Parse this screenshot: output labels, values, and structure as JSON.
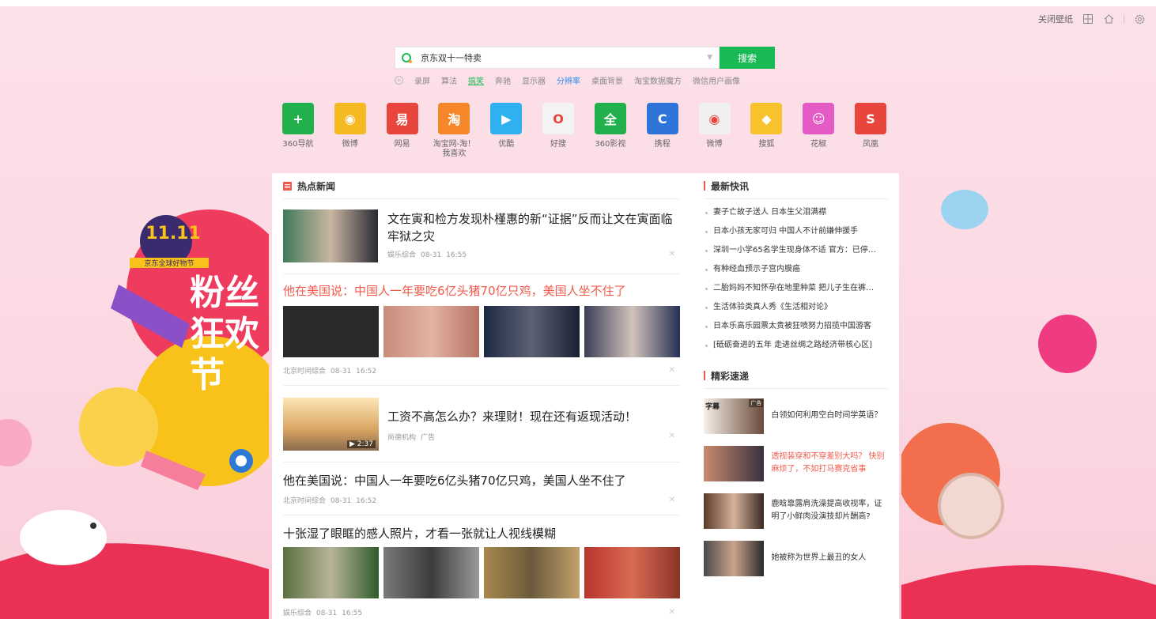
{
  "toolbar": {
    "close_wallpaper": "关闭壁纸"
  },
  "search": {
    "value": "京东双十一特卖",
    "button": "搜索"
  },
  "hot_words": [
    "录屏",
    "算法",
    "搞笑",
    "奔驰",
    "显示器",
    "分辨率",
    "桌面背景",
    "淘宝数据魔方",
    "微信用户画像"
  ],
  "sites": [
    {
      "label": "360导航",
      "glyph": "+",
      "color": "#21b04b",
      "icon": "plus-circle-icon"
    },
    {
      "label": "微博",
      "glyph": "◉",
      "color": "#f5b921",
      "icon": "weibo-icon"
    },
    {
      "label": "网易",
      "glyph": "易",
      "color": "#e8453c",
      "icon": "netease-icon"
    },
    {
      "label": "淘宝网-淘！我喜欢",
      "glyph": "淘",
      "color": "#f5862a",
      "icon": "taobao-icon"
    },
    {
      "label": "优酷",
      "glyph": "▶",
      "color": "#2fb1ef",
      "icon": "youku-icon"
    },
    {
      "label": "好搜",
      "glyph": "O",
      "color": "#f3f3f3",
      "icon": "haosou-icon"
    },
    {
      "label": "360影视",
      "glyph": "全",
      "color": "#21b04b",
      "icon": "360-video-icon"
    },
    {
      "label": "携程",
      "glyph": "C",
      "color": "#2f74d9",
      "icon": "ctrip-icon"
    },
    {
      "label": "微博",
      "glyph": "◉",
      "color": "#f0f0f0",
      "icon": "weibo-icon"
    },
    {
      "label": "搜狐",
      "glyph": "◆",
      "color": "#f7c22b",
      "icon": "sohu-icon"
    },
    {
      "label": "花椒",
      "glyph": "☺",
      "color": "#e55bc6",
      "icon": "huajiao-icon"
    },
    {
      "label": "凤凰",
      "glyph": "S",
      "color": "#e8453c",
      "icon": "ifeng-icon"
    }
  ],
  "hot_news": {
    "heading": "热点新闻",
    "items": [
      {
        "title": "文在寅和检方发现朴槿惠的新“证据”反而让文在寅面临牢狱之灾",
        "source": "娱乐综合",
        "date": "08-31",
        "time": "16:55"
      },
      {
        "title": "他在美国说：中国人一年要吃6亿头猪70亿只鸡，美国人坐不住了",
        "source": "北京时间综合",
        "date": "08-31",
        "time": "16:52"
      },
      {
        "title": "工资不高怎么办？来理财！现在还有返现活动！",
        "source": "尚德机构",
        "tag": "广告",
        "duration": "2:37"
      },
      {
        "title": "他在美国说：中国人一年要吃6亿头猪70亿只鸡，美国人坐不住了",
        "source": "北京时间综合",
        "date": "08-31",
        "time": "16:52"
      },
      {
        "title": "十张湿了眼眶的感人照片，才看一张就让人视线模糊",
        "source": "娱乐综合",
        "date": "08-31",
        "time": "16:55"
      }
    ]
  },
  "quick_news": {
    "heading": "最新快讯",
    "items": [
      "妻子亡故子送人 日本生父泪满襟",
      "日本小孩无家可归 中国人不计前嫌伸援手",
      "深圳一小学65名学生现身体不适 官方：已停…",
      "有种经血预示子宫内膜癌",
      "二胎妈妈不知怀孕在地里种菜 把儿子生在裤…",
      "生活体验类真人秀《生活相对论》",
      "日本乐高乐园票太贵被狂喷努力招揽中国游客",
      "[砥砺奋进的五年 走进丝绸之路经济带核心区]"
    ]
  },
  "promo": {
    "heading": "精彩速递",
    "ad_tag": "广告",
    "thumb_text": "字幕",
    "items": [
      {
        "text": "白领如何利用空白时间学英语？",
        "red": false
      },
      {
        "text": "透视装穿和不穿差别大吗？ 快别麻烦了，不如打马赛克省事",
        "red": true
      },
      {
        "text": "鹿晗靠露肩洗澡提高收视率，证明了小鲜肉没演技却片酬高?",
        "red": false
      },
      {
        "text": "她被称为世界上最丑的女人",
        "red": false
      }
    ]
  },
  "banner": {
    "logo": "11.11",
    "logo_sub": "京东全球好物节",
    "slogan": "粉丝狂欢节"
  },
  "colors": {
    "green": "#19b955",
    "red": "#f05a4b"
  }
}
